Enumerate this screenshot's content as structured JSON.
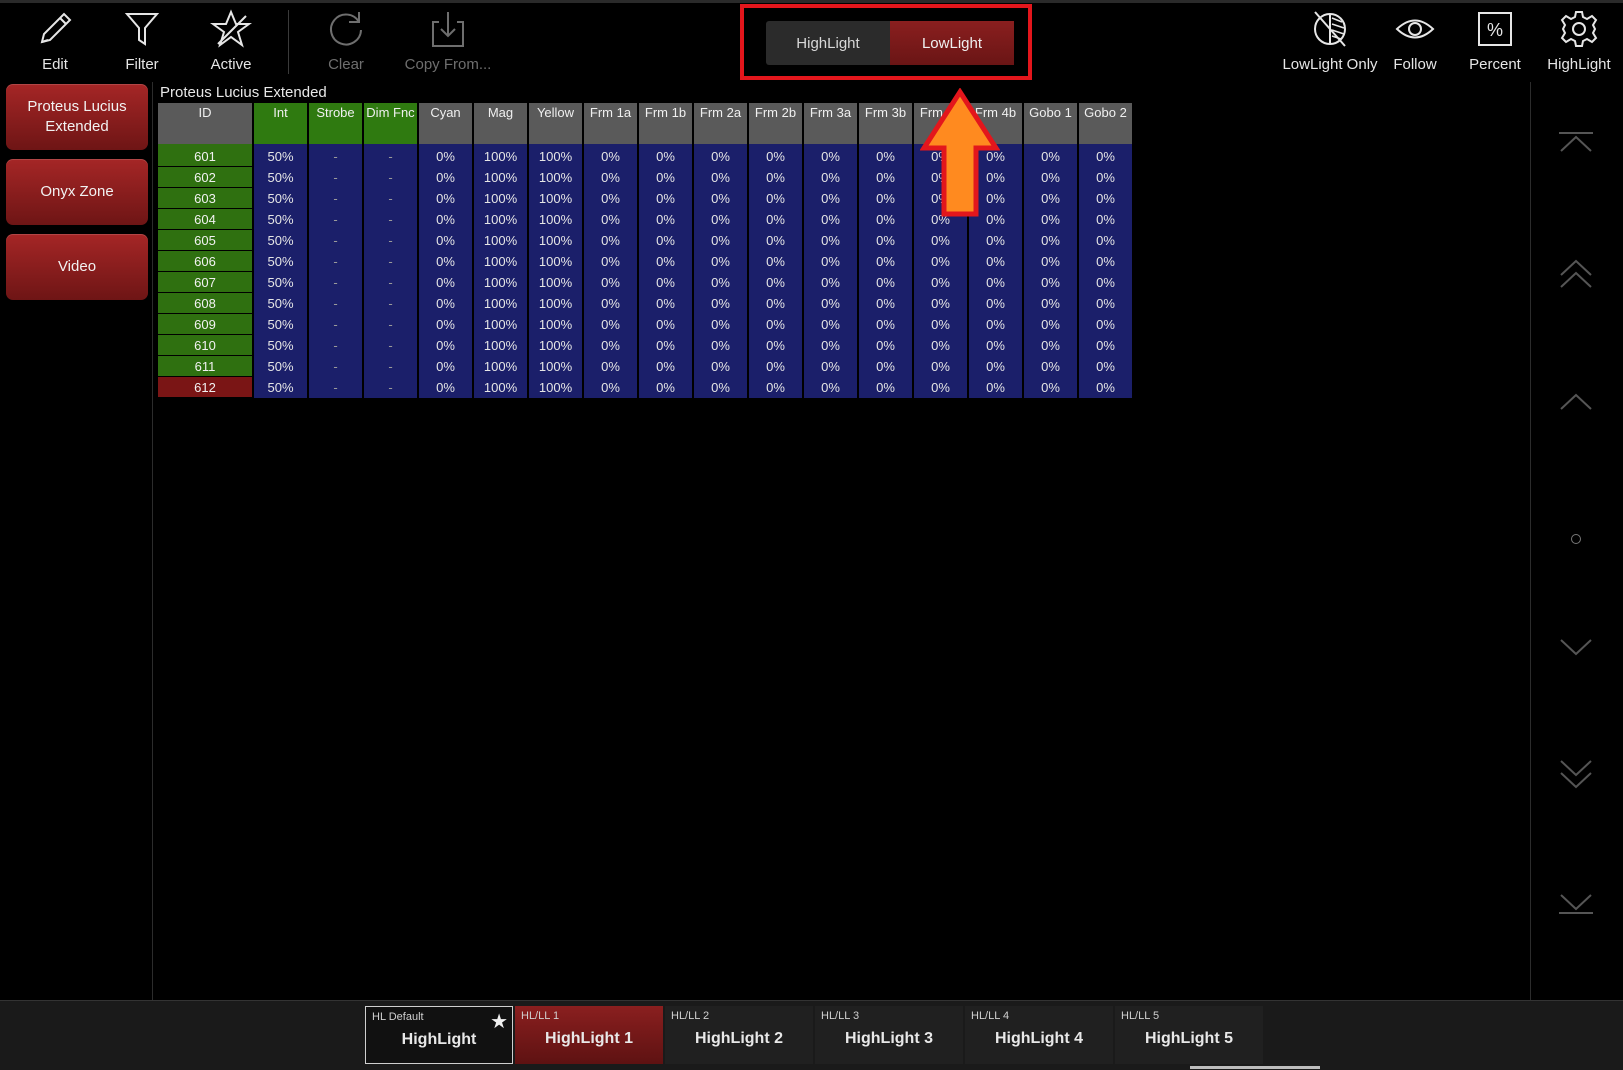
{
  "toolbar": {
    "edit_label": "Edit",
    "filter_label": "Filter",
    "active_label": "Active",
    "clear_label": "Clear",
    "copy_from_label": "Copy From..."
  },
  "hl_switch": {
    "highlight_label": "HighLight",
    "lowlight_label": "LowLight",
    "selected": "LowLight"
  },
  "right_toolbar": {
    "lowlight_only_label": "LowLight Only",
    "follow_label": "Follow",
    "percent_label": "Percent",
    "highlight_label": "HighLight"
  },
  "sidebar": {
    "items": [
      {
        "label": "Proteus Lucius Extended"
      },
      {
        "label": "Onyx Zone"
      },
      {
        "label": "Video"
      }
    ]
  },
  "grid": {
    "group_title": "Proteus Lucius Extended",
    "headers": [
      "ID",
      "Int",
      "Strobe",
      "Dim Fnc",
      "Cyan",
      "Mag",
      "Yellow",
      "Frm 1a",
      "Frm 1b",
      "Frm 2a",
      "Frm 2b",
      "Frm 3a",
      "Frm 3b",
      "Frm 4a",
      "Frm 4b",
      "Gobo 1",
      "Gobo 2"
    ],
    "green_headers": [
      "Int",
      "Strobe",
      "Dim Fnc"
    ],
    "rows": [
      [
        "601",
        "50%",
        "-",
        "-",
        "0%",
        "100%",
        "100%",
        "0%",
        "0%",
        "0%",
        "0%",
        "0%",
        "0%",
        "0%",
        "0%",
        "0%",
        "0%"
      ],
      [
        "602",
        "50%",
        "-",
        "-",
        "0%",
        "100%",
        "100%",
        "0%",
        "0%",
        "0%",
        "0%",
        "0%",
        "0%",
        "0%",
        "0%",
        "0%",
        "0%"
      ],
      [
        "603",
        "50%",
        "-",
        "-",
        "0%",
        "100%",
        "100%",
        "0%",
        "0%",
        "0%",
        "0%",
        "0%",
        "0%",
        "0%",
        "0%",
        "0%",
        "0%"
      ],
      [
        "604",
        "50%",
        "-",
        "-",
        "0%",
        "100%",
        "100%",
        "0%",
        "0%",
        "0%",
        "0%",
        "0%",
        "0%",
        "0%",
        "0%",
        "0%",
        "0%"
      ],
      [
        "605",
        "50%",
        "-",
        "-",
        "0%",
        "100%",
        "100%",
        "0%",
        "0%",
        "0%",
        "0%",
        "0%",
        "0%",
        "0%",
        "0%",
        "0%",
        "0%"
      ],
      [
        "606",
        "50%",
        "-",
        "-",
        "0%",
        "100%",
        "100%",
        "0%",
        "0%",
        "0%",
        "0%",
        "0%",
        "0%",
        "0%",
        "0%",
        "0%",
        "0%"
      ],
      [
        "607",
        "50%",
        "-",
        "-",
        "0%",
        "100%",
        "100%",
        "0%",
        "0%",
        "0%",
        "0%",
        "0%",
        "0%",
        "0%",
        "0%",
        "0%",
        "0%"
      ],
      [
        "608",
        "50%",
        "-",
        "-",
        "0%",
        "100%",
        "100%",
        "0%",
        "0%",
        "0%",
        "0%",
        "0%",
        "0%",
        "0%",
        "0%",
        "0%",
        "0%"
      ],
      [
        "609",
        "50%",
        "-",
        "-",
        "0%",
        "100%",
        "100%",
        "0%",
        "0%",
        "0%",
        "0%",
        "0%",
        "0%",
        "0%",
        "0%",
        "0%",
        "0%"
      ],
      [
        "610",
        "50%",
        "-",
        "-",
        "0%",
        "100%",
        "100%",
        "0%",
        "0%",
        "0%",
        "0%",
        "0%",
        "0%",
        "0%",
        "0%",
        "0%",
        "0%"
      ],
      [
        "611",
        "50%",
        "-",
        "-",
        "0%",
        "100%",
        "100%",
        "0%",
        "0%",
        "0%",
        "0%",
        "0%",
        "0%",
        "0%",
        "0%",
        "0%",
        "0%"
      ],
      [
        "612",
        "50%",
        "-",
        "-",
        "0%",
        "100%",
        "100%",
        "0%",
        "0%",
        "0%",
        "0%",
        "0%",
        "0%",
        "0%",
        "0%",
        "0%",
        "0%"
      ]
    ],
    "selected_id": "612"
  },
  "presets": [
    {
      "small": "HL Default",
      "label": "HighLight",
      "default": true
    },
    {
      "small": "HL/LL 1",
      "label": "HighLight 1",
      "active": true
    },
    {
      "small": "HL/LL 2",
      "label": "HighLight 2"
    },
    {
      "small": "HL/LL 3",
      "label": "HighLight 3"
    },
    {
      "small": "HL/LL 4",
      "label": "HighLight 4"
    },
    {
      "small": "HL/LL 5",
      "label": "HighLight 5"
    }
  ],
  "colors": {
    "accent_red": "#8a1f1f",
    "id_green": "#2f7010",
    "value_blue": "#1b1f6a",
    "annotation_red": "#e3161c",
    "annotation_arrow": "#ff8a1f"
  },
  "icons": [
    "pencil-icon",
    "filter-icon",
    "star-icon",
    "refresh-icon",
    "download-icon",
    "lowlight-only-icon",
    "eye-icon",
    "percent-icon",
    "gear-icon",
    "chevron-up-icon",
    "chevron-down-icon"
  ]
}
